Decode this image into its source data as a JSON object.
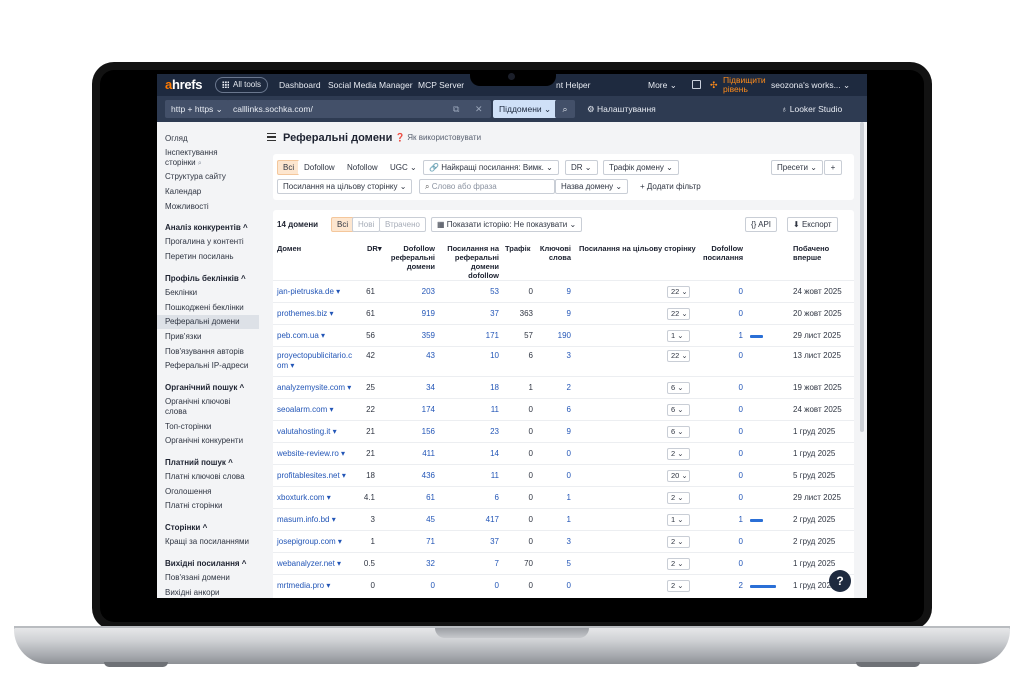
{
  "topbar": {
    "logo_a": "a",
    "logo_rest": "hrefs",
    "all_tools": "All tools",
    "nav": [
      "Dashboard",
      "Social Media Manager",
      "MCP Server",
      "nt Helper",
      "More"
    ],
    "upgrade_line1": "Підвищити",
    "upgrade_line2": "рівень",
    "account": "seozona's works..."
  },
  "urlbar": {
    "protocol": "http + https",
    "url": "calllinks.sochka.com/",
    "mode": "Піддомени",
    "settings": "Налаштування",
    "looker": "Looker Studio"
  },
  "sidebar": {
    "top": [
      "Огляд",
      "Інспектування",
      "сторінки",
      "Структура сайту",
      "Календар",
      "Можливості"
    ],
    "sec1_title": "Аналіз конкурентів",
    "sec1": [
      "Прогалина у контенті",
      "Перетин посилань"
    ],
    "sec2_title": "Профіль беклінків",
    "sec2": [
      "Беклінки",
      "Пошкоджені беклінки",
      "Реферальні домени",
      "Прив'язки",
      "Пов'язування авторів",
      "Реферальні IP-адреси"
    ],
    "sec3_title": "Органічний пошук",
    "sec3": [
      "Органічні ключові",
      "слова",
      "Топ-сторінки",
      "Органічні конкуренти"
    ],
    "sec4_title": "Платний пошук",
    "sec4": [
      "Платні ключові слова",
      "Оголошення",
      "Платні сторінки"
    ],
    "sec5_title": "Сторінки",
    "sec5": [
      "Кращі за посиланнями"
    ],
    "sec6_title": "Вихідні посилання",
    "sec6": [
      "Пов'язані домени",
      "Вихідні анкори"
    ]
  },
  "page": {
    "title": "Реферальні домени",
    "howto": "Як використовувати"
  },
  "filters": {
    "all": "Всі",
    "dofollow": "Dofollow",
    "nofollow": "Nofollow",
    "ugc": "UGC",
    "best_links": "Найкращі посилання: Вимк.",
    "dr": "DR",
    "traffic": "Трафік домену",
    "presets": "Пресети",
    "target_links": "Посилання на цільову сторінку",
    "search_placeholder": "Слово або фраза",
    "domain_name": "Назва домену",
    "add_filter": "Додати фільтр"
  },
  "table": {
    "count": "14 домени",
    "tab_all": "Всі",
    "tab_new": "Нові",
    "tab_lost": "Втрачено",
    "history": "Показати історію: Не показувати",
    "api": "API",
    "export": "Експорт",
    "headers": {
      "domain": "Домен",
      "dr": "DR",
      "dofollow_1": "Dofollow",
      "dofollow_2": "реферальні",
      "dofollow_3": "домени",
      "links_1": "Посилання на",
      "links_2": "реферальні",
      "links_3": "домени",
      "links_4": "dofollow",
      "traffic": "Трафік",
      "kw_1": "Ключові",
      "kw_2": "слова",
      "target": "Посилання на цільову сторінку",
      "dfl_1": "Dofollow",
      "dfl_2": "посилання",
      "first_1": "Побачено",
      "first_2": "вперше"
    },
    "rows": [
      {
        "domain": "jan-pietruska.de",
        "dr": "61",
        "dofollow_ref": "203",
        "links_dofollow": "53",
        "traffic": "0",
        "keywords": "9",
        "target": "22",
        "dofollow_links": "0",
        "first_seen": "24 жовт 2025",
        "bar": 0
      },
      {
        "domain": "prothemes.biz",
        "dr": "61",
        "dofollow_ref": "919",
        "links_dofollow": "37",
        "traffic": "363",
        "keywords": "9",
        "target": "22",
        "dofollow_links": "0",
        "first_seen": "20 жовт 2025",
        "bar": 0
      },
      {
        "domain": "peb.com.ua",
        "dr": "56",
        "dofollow_ref": "359",
        "links_dofollow": "171",
        "traffic": "57",
        "keywords": "190",
        "target": "1",
        "dofollow_links": "1",
        "first_seen": "29 лист 2025",
        "bar": 0.5
      },
      {
        "domain": "proyectopublicitario.c",
        "domain2": "om",
        "dr": "42",
        "dofollow_ref": "43",
        "links_dofollow": "10",
        "traffic": "6",
        "keywords": "3",
        "target": "22",
        "dofollow_links": "0",
        "first_seen": "13 лист 2025",
        "bar": 0
      },
      {
        "domain": "analyzemysite.com",
        "dr": "25",
        "dofollow_ref": "34",
        "links_dofollow": "18",
        "traffic": "1",
        "keywords": "2",
        "target": "6",
        "dofollow_links": "0",
        "first_seen": "19 жовт 2025",
        "bar": 0
      },
      {
        "domain": "seoalarm.com",
        "dr": "22",
        "dofollow_ref": "174",
        "links_dofollow": "11",
        "traffic": "0",
        "keywords": "6",
        "target": "6",
        "dofollow_links": "0",
        "first_seen": "24 жовт 2025",
        "bar": 0
      },
      {
        "domain": "valutahosting.it",
        "dr": "21",
        "dofollow_ref": "156",
        "links_dofollow": "23",
        "traffic": "0",
        "keywords": "9",
        "target": "6",
        "dofollow_links": "0",
        "first_seen": "1 груд 2025",
        "bar": 0
      },
      {
        "domain": "website-review.ro",
        "dr": "21",
        "dofollow_ref": "411",
        "links_dofollow": "14",
        "traffic": "0",
        "keywords": "0",
        "target": "2",
        "dofollow_links": "0",
        "first_seen": "1 груд 2025",
        "bar": 0
      },
      {
        "domain": "profitablesites.net",
        "dr": "18",
        "dofollow_ref": "436",
        "links_dofollow": "11",
        "traffic": "0",
        "keywords": "0",
        "target": "20",
        "dofollow_links": "0",
        "first_seen": "5 груд 2025",
        "bar": 0
      },
      {
        "domain": "xboxturk.com",
        "dr": "4.1",
        "dofollow_ref": "61",
        "links_dofollow": "6",
        "traffic": "0",
        "keywords": "1",
        "target": "2",
        "dofollow_links": "0",
        "first_seen": "29 лист 2025",
        "bar": 0
      },
      {
        "domain": "masum.info.bd",
        "dr": "3",
        "dofollow_ref": "45",
        "links_dofollow": "417",
        "traffic": "0",
        "keywords": "1",
        "target": "1",
        "dofollow_links": "1",
        "first_seen": "2 груд 2025",
        "bar": 0.5
      },
      {
        "domain": "josepigroup.com",
        "dr": "1",
        "dofollow_ref": "71",
        "links_dofollow": "37",
        "traffic": "0",
        "keywords": "3",
        "target": "2",
        "dofollow_links": "0",
        "first_seen": "2 груд 2025",
        "bar": 0
      },
      {
        "domain": "webanalyzer.net",
        "dr": "0.5",
        "dofollow_ref": "32",
        "links_dofollow": "7",
        "traffic": "70",
        "keywords": "5",
        "target": "2",
        "dofollow_links": "0",
        "first_seen": "1 груд 2025",
        "bar": 0
      },
      {
        "domain": "mrtmedia.pro",
        "dr": "0",
        "dofollow_ref": "0",
        "links_dofollow": "0",
        "traffic": "0",
        "keywords": "0",
        "target": "2",
        "dofollow_links": "2",
        "first_seen": "1 груд 2025",
        "bar": 1
      }
    ]
  },
  "help": "?",
  "colors": {
    "topbar": "#1e2a3f",
    "accent": "#ff7a00",
    "link": "#2356b7",
    "bar": "#2a6fd6"
  }
}
